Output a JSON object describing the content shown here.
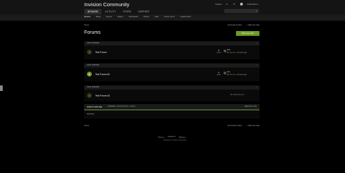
{
  "header": {
    "site_title": "Invision Community",
    "user_bar": {
      "create": "Create ▾",
      "notifications_icon": "bell-icon",
      "messages_icon": "envelope-icon",
      "user_name": "Guest Name ▾"
    },
    "nav": [
      "BROWSE",
      "ACTIVITY",
      "STORE",
      "SUPPORT"
    ],
    "search_placeholder": "Search",
    "subnav": [
      "Forums",
      "Blogs",
      "Events",
      "Gallery",
      "Downloads",
      "Videos",
      "Staff",
      "Online Users",
      "Leaderboard"
    ]
  },
  "breadcrumb": {
    "home": "Home",
    "unread": "Unread Content",
    "mark_read": "Mark site read"
  },
  "page": {
    "title": "Forums",
    "start_button": "Start new topic"
  },
  "categories": [
    {
      "name": "TEST FORUMS",
      "forums": [
        {
          "name": "Test Forum",
          "posts": "5",
          "posts_label": "posts",
          "last_title": "Test",
          "last_by": "By ",
          "last_user": "Test User",
          "last_time": ", 18 hours ago",
          "unread": false
        }
      ]
    },
    {
      "name": "TEST FORUMS",
      "forums": [
        {
          "name": "Test Forum #2",
          "posts": "4",
          "posts_label": "posts",
          "last_title": "Test",
          "last_by": "By ",
          "last_user": "Test User",
          "last_time": ", 18 hours ago",
          "unread": true
        }
      ]
    },
    {
      "name": "TEST FORUMS",
      "forums": [
        {
          "name": "Test Forum #3",
          "no_posts": "No posts here yet"
        }
      ]
    }
  ],
  "who_online": {
    "title": "WHO'S ONLINE",
    "sub": "1 MEMBER, 0 ANONYMOUS, 1 GUEST",
    "link": "(SEE FULL LIST)",
    "user": "Test User"
  },
  "footer": {
    "links": [
      "Theme ▾",
      "Contact Us",
      "Privacy ▾"
    ],
    "powered": "Powered by Invision Community"
  }
}
